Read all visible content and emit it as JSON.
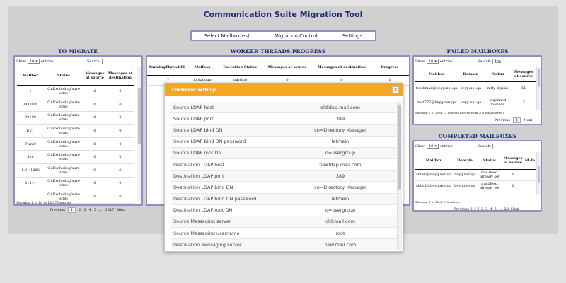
{
  "app": {
    "title": "Communication Suite Migration Tool",
    "nav": [
      "Select Mailbox(es)",
      "Migration Control",
      "Settings"
    ]
  },
  "to_migrate": {
    "title": "TO MIGRATE",
    "show_label": "Show",
    "show_value": "10",
    "entries_label": "entries",
    "search_label": "Search:",
    "search_value": "",
    "columns": [
      "Mailbox",
      "Status",
      "Messages at source",
      "Messages at destination"
    ],
    "rows": [
      [
        "1",
        "OnExcluding/sure sites",
        "0",
        "0"
      ],
      [
        "000000",
        "OnExcluding/sure sites",
        "0",
        "0"
      ],
      [
        "00100",
        "OnExcluding/sure sites",
        "0",
        "0"
      ],
      [
        "EV1",
        "OnExcluding/sure sites",
        "0",
        "0"
      ],
      [
        "Fwm0",
        "OnExcluding/sure sites",
        "0",
        "0"
      ],
      [
        "Sv0",
        "OnExcluding/sure sites",
        "0",
        "0"
      ],
      [
        "1-31-1990",
        "OnExcluding/sure sites",
        "0",
        "0"
      ],
      [
        "21444",
        "OnExcluding/sure sites",
        "0",
        "0"
      ],
      [
        "",
        "OnExcluding/sure sites",
        "0",
        "0"
      ]
    ],
    "footer": "Showing 1 to 10 of 18,270 entries",
    "pager": [
      "Previous",
      "1",
      "2",
      "3",
      "4",
      "5",
      "...",
      "1827",
      "Next"
    ]
  },
  "worker_threads": {
    "title": "WORKER THREADS PROGRESS",
    "columns": [
      "RunningThread ID",
      "Mailbox",
      "Execution Status",
      "Messages at source",
      "Messages at destination",
      "Progress"
    ],
    "rows": [
      [
        "17",
        "lookingup",
        "starting",
        "0",
        "0",
        "1"
      ]
    ]
  },
  "failed": {
    "title": "FAILED MAILBOXES",
    "show_label": "Show",
    "show_value": "10",
    "entries_label": "entries",
    "search_label": "Search:",
    "search_value": "tes",
    "columns": [
      "Mailbox",
      "Domain",
      "Status",
      "Messages at source"
    ],
    "rows": [
      [
        "testlimail@beyg.net.qa",
        "beyg.net.qa",
        "mtly dtyisis",
        "51"
      ],
      [
        "test777@beyg.net.qa",
        "beyg.net.qa",
        "unplaned mailbox",
        "3"
      ]
    ],
    "footer": "Showing 1 to 10 of 12 entries (filtered from 200 total entries)",
    "pager": [
      "Previous",
      "1",
      "Next"
    ]
  },
  "completed": {
    "title": "COMPLETED MAILBOXES",
    "show_label": "Show",
    "show_value": "10",
    "entries_label": "entries",
    "search_label": "Search:",
    "search_value": "",
    "columns": [
      "Mailbox",
      "Domain",
      "Status",
      "Messages at source",
      "M de"
    ],
    "rows": [
      [
        "sbbe0@beyg.net.qa",
        "beyg.net.qa",
        "mw2Bext already set",
        "0"
      ],
      [
        "sbbe1@beyg.net.qa",
        "beyg.net.qa",
        "mw2Bext already set",
        "0"
      ]
    ],
    "footer": "Showing 1 to 10 of 218 entries",
    "pager": [
      "Previous",
      "1",
      "2",
      "3",
      "4",
      "5",
      "...",
      "22",
      "Next"
    ]
  },
  "controller": {
    "title": "Controller settings",
    "close_glyph": "×",
    "settings": [
      {
        "key": "Source LDAP host",
        "value": "oldldap.mail.com"
      },
      {
        "key": "Source LDAP port",
        "value": "389"
      },
      {
        "key": "Source LDAP bind DN",
        "value": "cn=Directory Manager"
      },
      {
        "key": "Source LDAP bind DN password",
        "value": "letmein"
      },
      {
        "key": "Source LDAP root DN",
        "value": "o=usergroup"
      },
      {
        "key": "Destination LDAP host",
        "value": "newldap.mail.com"
      },
      {
        "key": "Destination LDAP port",
        "value": "389"
      },
      {
        "key": "Destination LDAP bind DN",
        "value": "cn=Directory Manager"
      },
      {
        "key": "Destination LDAP bind DN password",
        "value": "letmein"
      },
      {
        "key": "Destination LDAP root DN",
        "value": "o=usergroup"
      },
      {
        "key": "Source Messaging server",
        "value": "old.mail.com"
      },
      {
        "key": "Source Messaging username",
        "value": "root"
      },
      {
        "key": "Destination Messaging server",
        "value": "new.mail.com"
      }
    ]
  },
  "colors": {
    "accent_border": "#8f8fc6",
    "title_blue": "#1c2a78",
    "modal_header": "#f5a623"
  }
}
